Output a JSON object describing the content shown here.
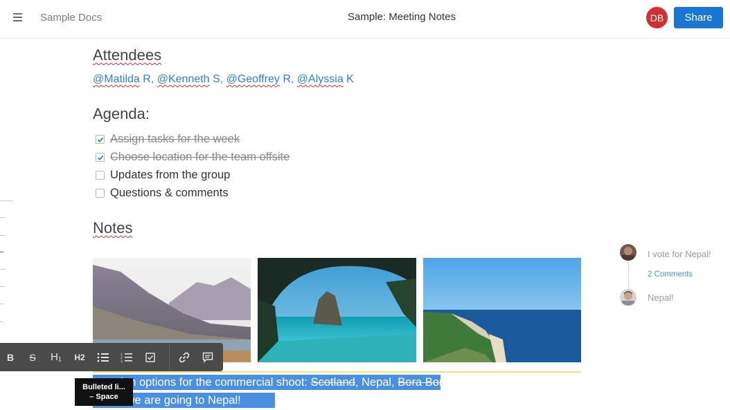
{
  "header": {
    "brand": "Sample Docs",
    "title": "Sample: Meeting Notes",
    "avatar_initials": "DB",
    "share_label": "Share",
    "avatar_color": "#d32f2f",
    "accent": "#1976d2"
  },
  "attendees": {
    "heading": "Attendees",
    "people": [
      {
        "handle": "@Matilda",
        "suffix": " R"
      },
      {
        "handle": "@Kenneth",
        "suffix": " S"
      },
      {
        "handle": "@Geoffrey",
        "suffix": " R"
      },
      {
        "handle": "@Alyssia",
        "suffix": " K"
      }
    ]
  },
  "agenda": {
    "heading": "Agenda:",
    "items": [
      {
        "label": "Assign tasks for the week",
        "done": true
      },
      {
        "label": "Choose location for the team offsite",
        "done": true
      },
      {
        "label": "Updates from the group",
        "done": false
      },
      {
        "label": "Questions & comments",
        "done": false
      }
    ]
  },
  "notes": {
    "heading": "Notes",
    "images": [
      {
        "name": "mountain-lake-photo"
      },
      {
        "name": "sea-cave-rock-photo"
      },
      {
        "name": "coastal-cliff-photo"
      }
    ],
    "selected_lines": [
      "Location options for the commercial shoot: ",
      "Scotland",
      ", Nepal, ",
      "Bora Bora",
      "Looks we are going to Nepal!"
    ]
  },
  "comments": {
    "first": "I vote for Nepal!",
    "count_link": "2 Comments",
    "second": "Nepal!"
  },
  "toolbar": {
    "bold": "B",
    "strike": "S",
    "h1": "H₁",
    "h2": "H2",
    "tooltip_title": "Bulleted li...",
    "tooltip_shortcut": "–  Space"
  }
}
